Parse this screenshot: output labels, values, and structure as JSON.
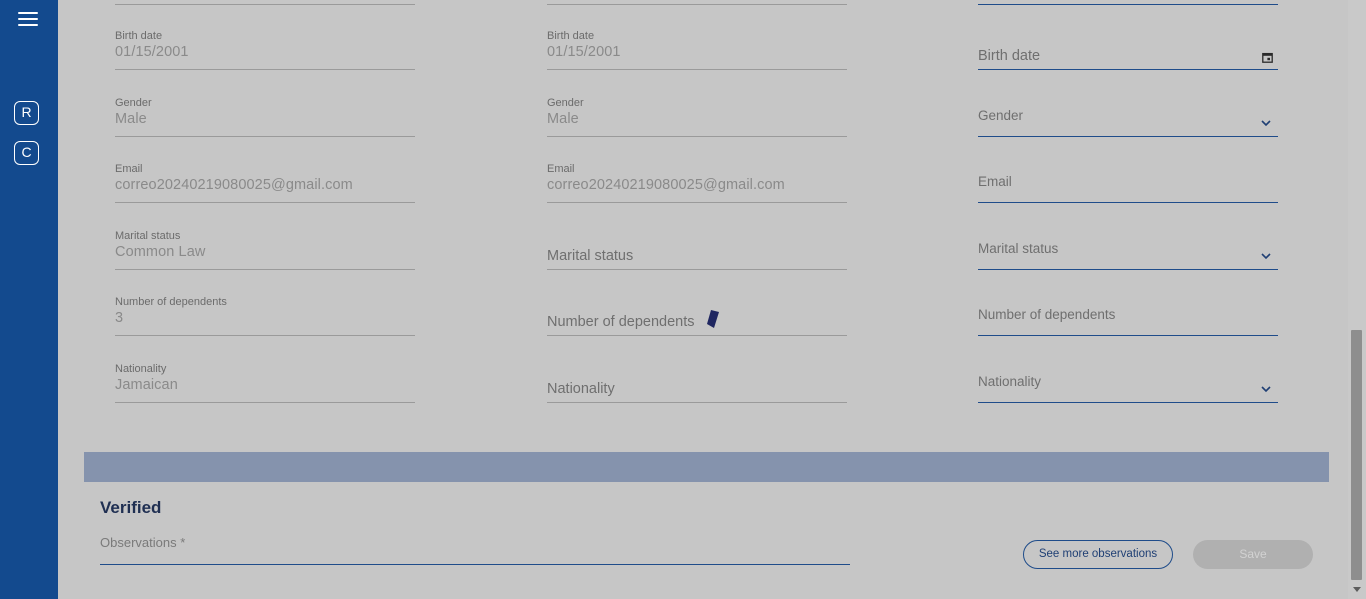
{
  "sidebar": {
    "menu_icon": "hamburger-menu-icon",
    "badges": [
      "R",
      "C"
    ]
  },
  "col1": {
    "birth_date": {
      "label": "Birth date",
      "value": "01/15/2001"
    },
    "gender": {
      "label": "Gender",
      "value": "Male"
    },
    "email": {
      "label": "Email",
      "value": "correo20240219080025@gmail.com"
    },
    "marital_status": {
      "label": "Marital status",
      "value": "Common Law"
    },
    "dependents": {
      "label": "Number of dependents",
      "value": "3"
    },
    "nationality": {
      "label": "Nationality",
      "value": "Jamaican"
    }
  },
  "col2": {
    "birth_date": {
      "label": "Birth date",
      "value": "01/15/2001"
    },
    "gender": {
      "label": "Gender",
      "value": "Male"
    },
    "email": {
      "label": "Email",
      "value": "correo20240219080025@gmail.com"
    },
    "marital_status": {
      "placeholder": "Marital status"
    },
    "dependents": {
      "placeholder": "Number of dependents"
    },
    "nationality": {
      "placeholder": "Nationality"
    }
  },
  "col3": {
    "birth_date": {
      "placeholder": "Birth date"
    },
    "gender": {
      "placeholder": "Gender"
    },
    "email": {
      "placeholder": "Email"
    },
    "marital_status": {
      "placeholder": "Marital status"
    },
    "dependents": {
      "placeholder": "Number of dependents"
    },
    "nationality": {
      "placeholder": "Nationality"
    }
  },
  "verification": {
    "title": "Verified",
    "observations_placeholder": "Observations *",
    "see_more_label": "See more observations",
    "save_label": "Save"
  },
  "colors": {
    "sidebar": "#134a8e",
    "accent": "#1f4c8a",
    "banner": "#8593ad"
  }
}
